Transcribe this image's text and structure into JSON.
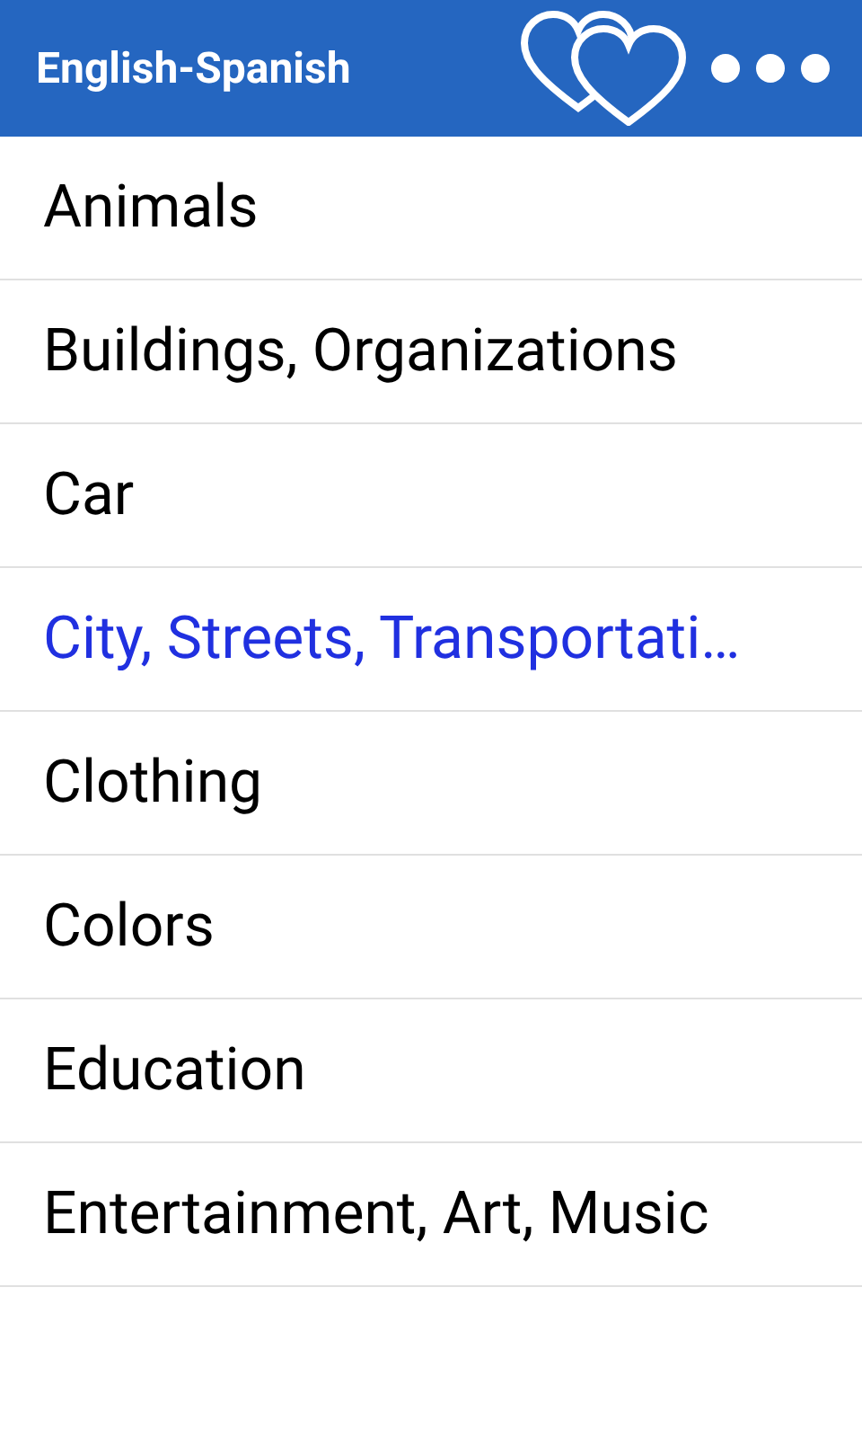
{
  "header": {
    "title": "English-Spanish"
  },
  "categories": [
    {
      "label": "Animals",
      "selected": false
    },
    {
      "label": "Buildings, Organizations",
      "selected": false
    },
    {
      "label": "Car",
      "selected": false
    },
    {
      "label": "City, Streets, Transportati…",
      "selected": true
    },
    {
      "label": "Clothing",
      "selected": false
    },
    {
      "label": "Colors",
      "selected": false
    },
    {
      "label": "Education",
      "selected": false
    },
    {
      "label": "Entertainment, Art, Music",
      "selected": false
    }
  ]
}
